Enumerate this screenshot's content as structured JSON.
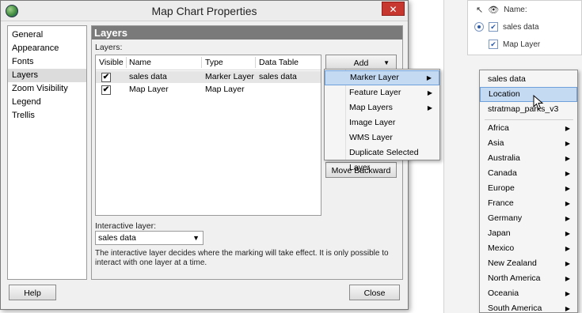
{
  "dialog": {
    "title": "Map Chart Properties",
    "close_label": "✕",
    "help_label": "Help",
    "close_button_label": "Close"
  },
  "nav": {
    "items": [
      "General",
      "Appearance",
      "Fonts",
      "Layers",
      "Zoom Visibility",
      "Legend",
      "Trellis"
    ],
    "selected": "Layers"
  },
  "layers_page": {
    "header": "Layers",
    "layers_label": "Layers:",
    "columns": [
      "Visible",
      "Name",
      "Type",
      "Data Table"
    ],
    "rows": [
      {
        "visible": "✔",
        "name": "sales data",
        "type": "Marker Layer",
        "data_table": "sales data"
      },
      {
        "visible": "✔",
        "name": "Map Layer",
        "type": "Map Layer",
        "data_table": ""
      }
    ],
    "add_label": "Add",
    "move_backward_label": "Move Backward",
    "interactive_label": "Interactive layer:",
    "interactive_value": "sales data",
    "info_text": "The interactive layer decides where the marking will take effect. It is only possible to interact with one layer at a time."
  },
  "add_menu": {
    "items": [
      {
        "label": "Marker Layer",
        "submenu": true,
        "highlighted": true
      },
      {
        "label": "Feature Layer",
        "submenu": true
      },
      {
        "label": "Map Layers",
        "submenu": true
      },
      {
        "label": "Image Layer",
        "submenu": false
      },
      {
        "label": "WMS Layer",
        "submenu": false
      },
      {
        "label": "Duplicate Selected Layer",
        "submenu": false
      }
    ]
  },
  "marker_submenu": {
    "top_items": [
      "sales data",
      "Location",
      "stratmap_parks_v3"
    ],
    "highlighted": "Location",
    "regions": [
      "Africa",
      "Asia",
      "Australia",
      "Canada",
      "Europe",
      "France",
      "Germany",
      "Japan",
      "Mexico",
      "New Zealand",
      "North America",
      "Oceania",
      "South America"
    ]
  },
  "background_app": {
    "name_header": "Name:",
    "items": [
      "sales data",
      "Map Layer"
    ]
  },
  "colors": {
    "accent_highlight": "#c4d9f2",
    "close_red": "#c7372f",
    "header_gray": "#7a7a7a"
  }
}
